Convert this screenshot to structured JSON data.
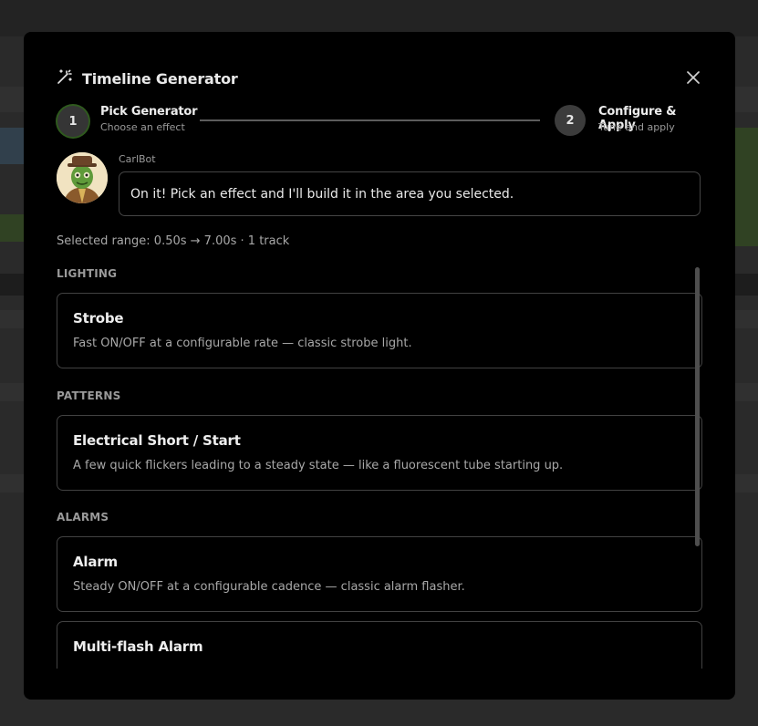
{
  "dialog": {
    "title": "Timeline Generator",
    "header_icon": "magic-wand-icon",
    "close_icon": "close-icon"
  },
  "steps": [
    {
      "number": "1",
      "title": "Pick Generator",
      "subtitle": "Choose an effect",
      "active": true
    },
    {
      "number": "2",
      "title": "Configure & Apply",
      "subtitle": "Tune and apply",
      "active": false
    }
  ],
  "bot": {
    "name": "CarlBot",
    "message": "On it! Pick an effect and I'll build it in the area you selected."
  },
  "selection": {
    "summary": "Selected range: 0.50s → 7.00s · 1 track"
  },
  "categories": [
    {
      "label": "LIGHTING",
      "effects": [
        {
          "name": "Strobe",
          "description": "Fast ON/OFF at a configurable rate — classic strobe light."
        }
      ]
    },
    {
      "label": "PATTERNS",
      "effects": [
        {
          "name": "Electrical Short / Start",
          "description": "A few quick flickers leading to a steady state — like a fluorescent tube starting up."
        }
      ]
    },
    {
      "label": "ALARMS",
      "effects": [
        {
          "name": "Alarm",
          "description": "Steady ON/OFF at a configurable cadence — classic alarm flasher."
        },
        {
          "name": "Multi-flash Alarm",
          "description": ""
        }
      ]
    }
  ],
  "colors": {
    "modal_bg": "#000000",
    "step_active_ring": "#2f5a1e",
    "card_border": "#424242"
  }
}
